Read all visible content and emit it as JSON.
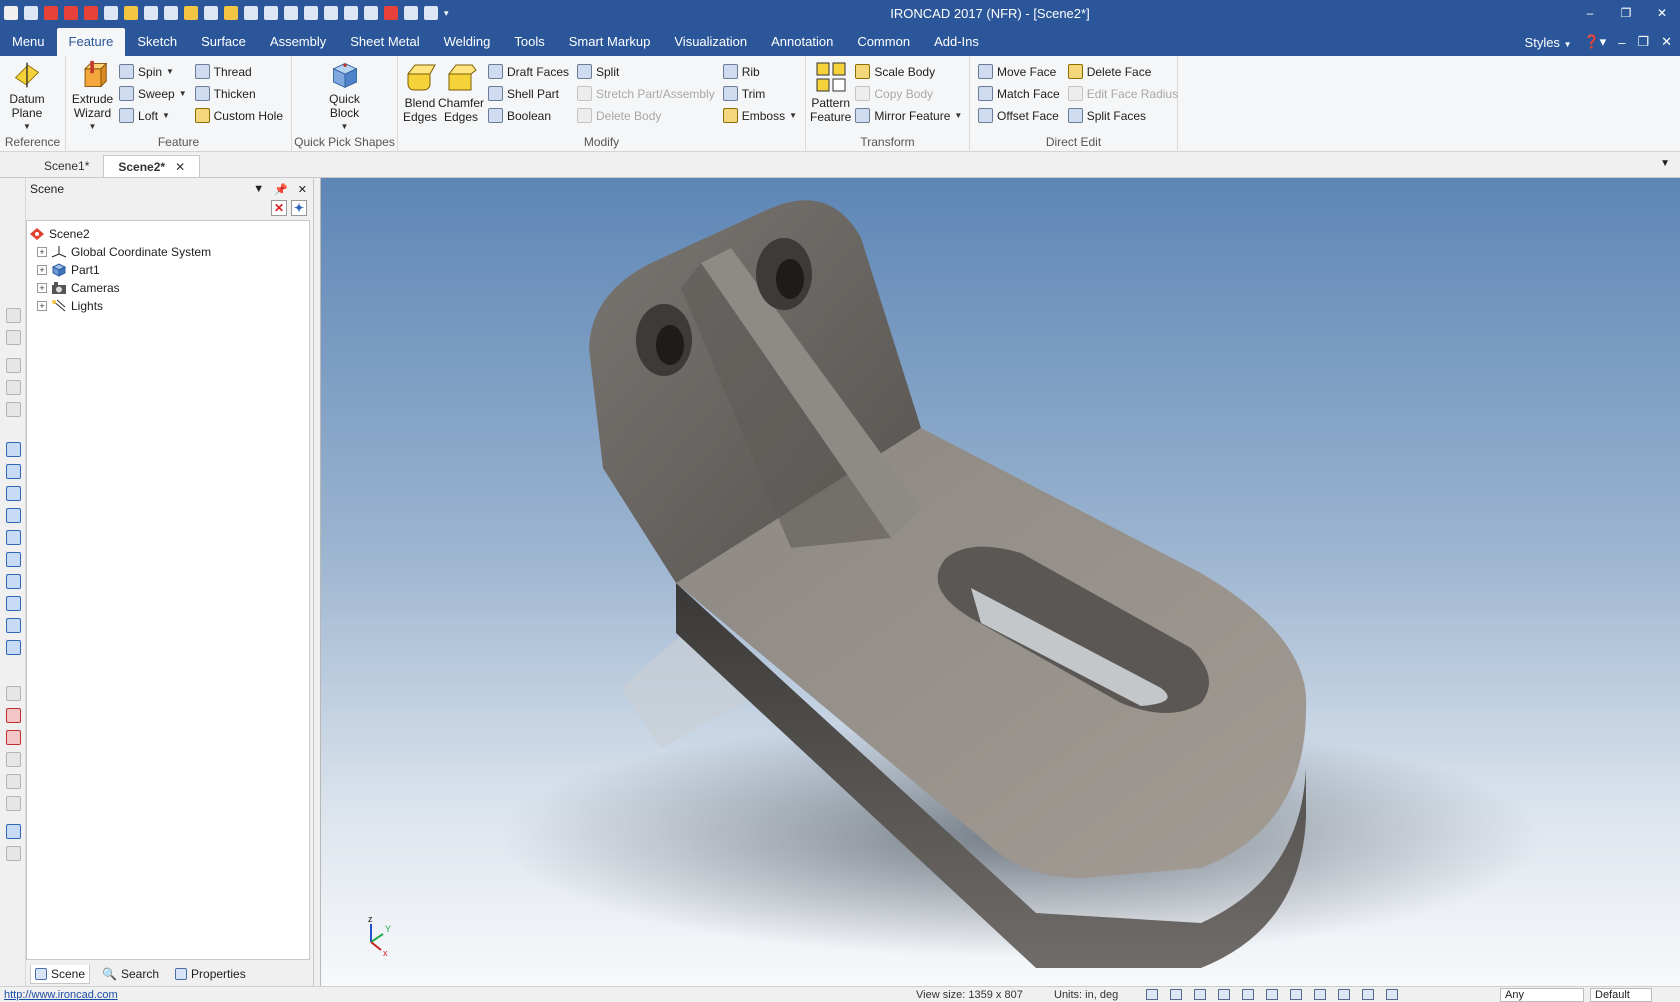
{
  "window": {
    "title": "IRONCAD 2017 (NFR) - [Scene2*]",
    "controls": [
      "–",
      "❐",
      "✕"
    ]
  },
  "menu": {
    "tabs": [
      "Menu",
      "Feature",
      "Sketch",
      "Surface",
      "Assembly",
      "Sheet Metal",
      "Welding",
      "Tools",
      "Smart Markup",
      "Visualization",
      "Annotation",
      "Common",
      "Add-Ins"
    ],
    "active_tab": "Feature",
    "styles_label": "Styles"
  },
  "ribbon": {
    "reference": {
      "label": "Reference",
      "datum_plane": "Datum Plane"
    },
    "feature": {
      "label": "Feature",
      "extrude_wizard": "Extrude Wizard",
      "spin": "Spin",
      "sweep": "Sweep",
      "loft": "Loft",
      "thread": "Thread",
      "thicken": "Thicken",
      "custom_hole": "Custom Hole"
    },
    "quick_pick": {
      "label": "Quick Pick Shapes",
      "quick_block": "Quick Block"
    },
    "modify": {
      "label": "Modify",
      "blend_edges": "Blend Edges",
      "chamfer_edges": "Chamfer Edges",
      "draft_faces": "Draft Faces",
      "shell_part": "Shell Part",
      "boolean": "Boolean",
      "split": "Split",
      "stretch_part": "Stretch Part/Assembly",
      "delete_body": "Delete Body",
      "rib": "Rib",
      "trim": "Trim",
      "emboss": "Emboss"
    },
    "transform": {
      "label": "Transform",
      "pattern_feature": "Pattern Feature",
      "scale_body": "Scale Body",
      "copy_body": "Copy Body",
      "mirror_feature": "Mirror Feature"
    },
    "direct_edit": {
      "label": "Direct Edit",
      "move_face": "Move Face",
      "match_face": "Match Face",
      "offset_face": "Offset Face",
      "delete_face": "Delete Face",
      "edit_face_radius": "Edit Face Radius",
      "split_faces": "Split Faces"
    }
  },
  "doc_tabs": [
    "Scene1*",
    "Scene2*"
  ],
  "active_doc": "Scene2*",
  "scene_panel": {
    "title": "Scene",
    "tree": {
      "root": "Scene2",
      "children": [
        "Global Coordinate System",
        "Part1",
        "Cameras",
        "Lights"
      ]
    },
    "tabs": [
      "Scene",
      "Search",
      "Properties"
    ]
  },
  "viewport": {
    "axes": {
      "z": "z",
      "y": "Y",
      "x": "x"
    }
  },
  "status": {
    "url": "http://www.ironcad.com",
    "view_size": "View size: 1359 x 807",
    "units": "Units: in, deg",
    "filter_combo": "Any",
    "style_combo": "Default"
  },
  "colors": {
    "title_bar": "#2b579a",
    "part": "#8a8580"
  }
}
